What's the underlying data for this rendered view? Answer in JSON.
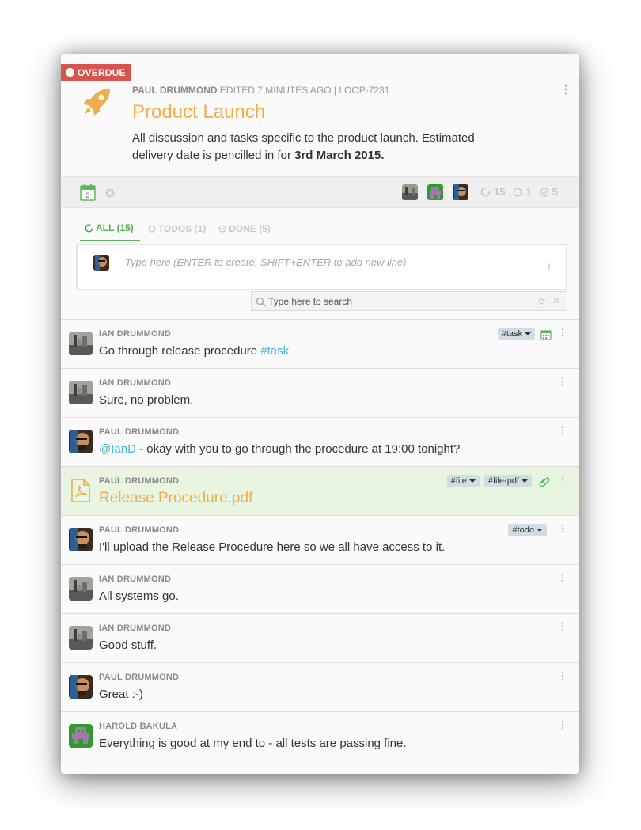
{
  "header": {
    "badge": "OVERDUE",
    "author": "PAUL DRUMMOND",
    "edited": " EDITED 7 MINUTES AGO | LOOP-7231",
    "title": "Product Launch",
    "description_start": "All discussion and tasks specific to the product launch. Estimated delivery date is pencilled in for ",
    "description_date": "3rd March 2015."
  },
  "toolbar": {
    "calendar_day": "3",
    "stats": {
      "all": "15",
      "open": "1",
      "done": "5"
    }
  },
  "tabs": [
    {
      "label": "ALL (15)"
    },
    {
      "label": "TODOS (1)"
    },
    {
      "label": "DONE (5)"
    }
  ],
  "composer": {
    "placeholder": "Type here (ENTER to create, SHIFT+ENTER to add new line)"
  },
  "search": {
    "placeholder": "Type here to search"
  },
  "messages": [
    {
      "author": "IAN DRUMMOND",
      "text": "Go through release procedure ",
      "hashtag": "#task",
      "tags": [
        "#task"
      ]
    },
    {
      "author": "IAN DRUMMOND",
      "text": "Sure, no problem."
    },
    {
      "author": "PAUL DRUMMOND",
      "mention": "@IanD",
      "text": " - okay with you to go through the procedure at 19:00 tonight?"
    },
    {
      "author": "PAUL DRUMMOND",
      "filename": "Release Procedure.pdf",
      "tags": [
        "#file",
        "#file-pdf"
      ]
    },
    {
      "author": "PAUL DRUMMOND",
      "text": "I'll upload the Release Procedure here so we all have access to it.",
      "tags": [
        "#todo"
      ]
    },
    {
      "author": "IAN DRUMMOND",
      "text": "All systems go."
    },
    {
      "author": "IAN DRUMMOND",
      "text": "Good stuff."
    },
    {
      "author": "PAUL DRUMMOND",
      "text": "Great :-)"
    },
    {
      "author": "HAROLD BAKULA",
      "text": "Everything is good at my end to - all tests are passing fine."
    }
  ],
  "colors": {
    "accent_orange": "#f0ad4e",
    "accent_green": "#5cb85c",
    "overdue_red": "#d9534f",
    "link_blue": "#46b8da",
    "file_row_bg": "#e8f5e0"
  }
}
